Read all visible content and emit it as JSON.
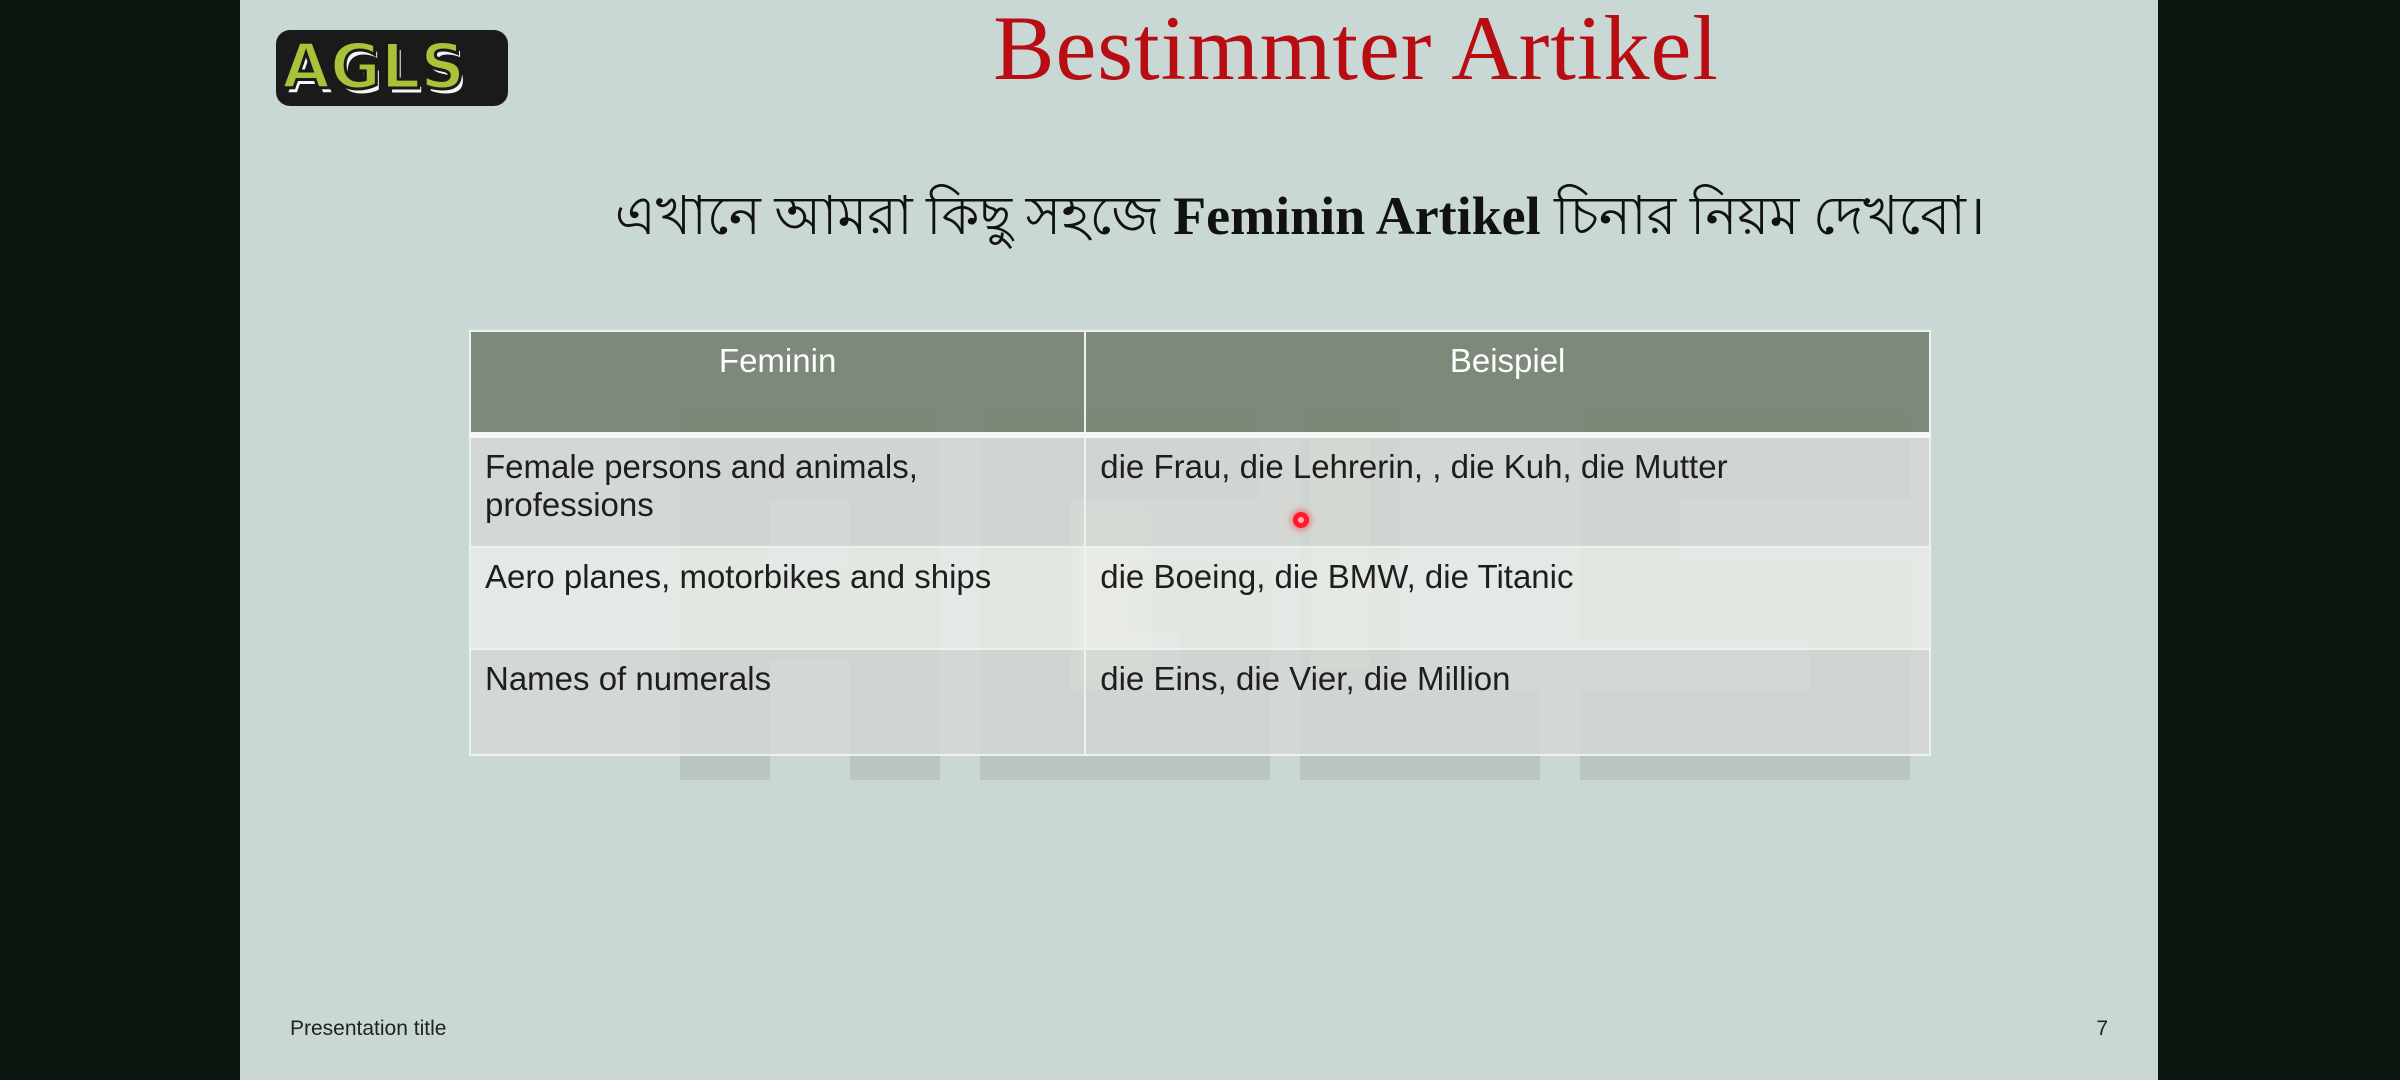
{
  "logo": {
    "text": "AGLS"
  },
  "slide": {
    "title": "Bestimmter Artikel",
    "subtitle": {
      "part1": "এখানে  আমরা  কিছু  সহজে ",
      "bold": "Feminin Artikel",
      "part2": " চিনার  নিয়ম দেখবো।"
    }
  },
  "table": {
    "headers": [
      "Feminin",
      "Beispiel"
    ],
    "rows": [
      [
        "Female persons and animals, professions",
        "die Frau, die Lehrerin, , die Kuh, die Mutter"
      ],
      [
        "Aero planes, motorbikes and ships",
        "die Boeing, die BMW, die Titanic"
      ],
      [
        "Names of numerals",
        "die Eins, die Vier, die Million"
      ]
    ]
  },
  "footer": {
    "presentation_title": "Presentation title",
    "page_number": "7"
  },
  "colors": {
    "background": "#0b160f",
    "slide": "#c9d8d4",
    "title": "#b80d13",
    "header_fill": "#7a8576",
    "logo_green": "#a8c23a",
    "pointer": "#ff1a2a"
  }
}
